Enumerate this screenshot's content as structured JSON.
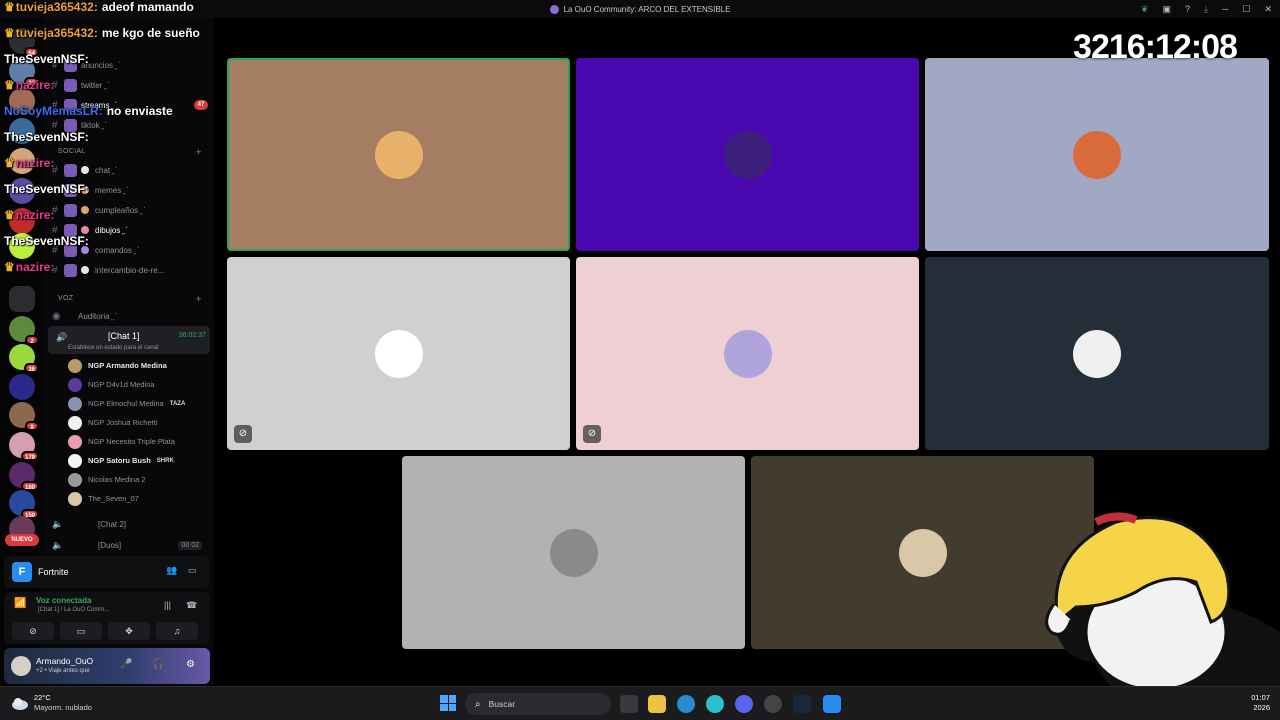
{
  "window": {
    "title": "La OuO Community: ARCO DEL EXTENSIBLE"
  },
  "timer": "3216:12:08",
  "chat": [
    {
      "user": "tuvieja365432:",
      "msg": "adeof mamando",
      "color": "orange",
      "crown": true
    },
    {
      "user": "tuvieja365432:",
      "msg": "me kgo de sueño",
      "color": "orange",
      "crown": true
    },
    {
      "user": "TheSevenNSF:",
      "msg": "",
      "color": "white",
      "crown": false
    },
    {
      "user": "nazire:",
      "msg": "",
      "color": "pink",
      "crown": true
    },
    {
      "user": "NoSoyMemasLR:",
      "msg": "no enviaste",
      "color": "blue",
      "crown": false
    },
    {
      "user": "TheSevenNSF:",
      "msg": "",
      "color": "white",
      "crown": false
    },
    {
      "user": "nazire:",
      "msg": "",
      "color": "pink",
      "crown": true
    },
    {
      "user": "TheSevenNSF:",
      "msg": "",
      "color": "white",
      "crown": false
    },
    {
      "user": "nazire:",
      "msg": "",
      "color": "pink",
      "crown": true
    },
    {
      "user": "TheSevenNSF:",
      "msg": "",
      "color": "white",
      "crown": false
    },
    {
      "user": "nazire:",
      "msg": "",
      "color": "pink",
      "crown": true
    }
  ],
  "rail": {
    "badges": [
      "64",
      "23",
      "2",
      "36",
      "9",
      "179",
      "180",
      "150"
    ],
    "nuevo": "NUEVO"
  },
  "channels": {
    "text": [
      {
        "name": "anuncios ̗ˏˋ",
        "prefix": ""
      },
      {
        "name": "twitter ̗ˏˋ",
        "prefix": ""
      },
      {
        "name": "streams ̗ˏˋ",
        "prefix": "",
        "badge": "47",
        "active": true
      },
      {
        "name": "tiktok ̗ˏˋ",
        "prefix": ""
      }
    ],
    "social_cat": "SOCIAL",
    "social": [
      {
        "name": "chat ̗ˏˋ"
      },
      {
        "name": "memes ̗ˏˋ"
      },
      {
        "name": "cumpleaños ̗ˏˋ"
      },
      {
        "name": "dibujos ̗ˏˋ",
        "active": true
      },
      {
        "name": "comandos ̗ˏˋ"
      },
      {
        "name": "intercambio-de-re..."
      }
    ],
    "voice_cat": "VOZ",
    "auditoria": "Auditoria ̗ˏˋ",
    "current_voice": {
      "name": "[Chat 1]",
      "time": "36:02:37",
      "status": "Establece un estado para el canal"
    },
    "members": [
      {
        "name": "NGP Armando Medina",
        "bold": true,
        "tag": ""
      },
      {
        "name": "NGP D4v1d Medina",
        "bold": false,
        "tag": ""
      },
      {
        "name": "NGP Elmochul Medina",
        "bold": false,
        "tag": "TAZA"
      },
      {
        "name": "NGP Joshua Richetti",
        "bold": false,
        "tag": ""
      },
      {
        "name": "NGP Necesito Triple Plata",
        "bold": false,
        "tag": ""
      },
      {
        "name": "NGP Satoru Bush",
        "bold": true,
        "tag": "SHRK"
      },
      {
        "name": "Nicolas Medina 2",
        "bold": false,
        "tag": ""
      },
      {
        "name": "The_Seven_07",
        "bold": false,
        "tag": ""
      }
    ],
    "voice_more": [
      {
        "name": "[Chat 2]",
        "count": ""
      },
      {
        "name": "[Duos]",
        "count": "00  02"
      }
    ]
  },
  "activity": {
    "game": "Fortnite"
  },
  "voice_connection": {
    "status": "Voz conectada",
    "where": "[Chat 1]  / La OuO Comm..."
  },
  "user": {
    "name": "Armando_OuO",
    "status": "+2 • Viaje antes que"
  },
  "taskbar": {
    "weather_temp": "22°C",
    "weather_desc": "Mayorm. nublado",
    "search": "Buscar",
    "time": "01:07",
    "date": "2026"
  },
  "tiles": [
    {
      "bg": "#a47d62",
      "avatar": "#e8b26a",
      "speaking": true,
      "muted": false
    },
    {
      "bg": "#4a09b0",
      "avatar": "#3b1f7a",
      "speaking": false,
      "muted": false
    },
    {
      "bg": "#a0a8c4",
      "avatar": "#d86a3c",
      "speaking": false,
      "muted": false
    },
    {
      "bg": "#d0d0d0",
      "avatar": "#ffffff",
      "speaking": false,
      "muted": true
    },
    {
      "bg": "#eed0d4",
      "avatar": "#b0a4dc",
      "speaking": false,
      "muted": true
    },
    {
      "bg": "#242e38",
      "avatar": "#f0f0f0",
      "speaking": false,
      "muted": false
    },
    {
      "bg": "#b2b2b2",
      "avatar": "#8a8a8a",
      "speaking": false,
      "muted": false
    },
    {
      "bg": "#423c2e",
      "avatar": "#d8c8a8",
      "speaking": false,
      "muted": false
    }
  ]
}
